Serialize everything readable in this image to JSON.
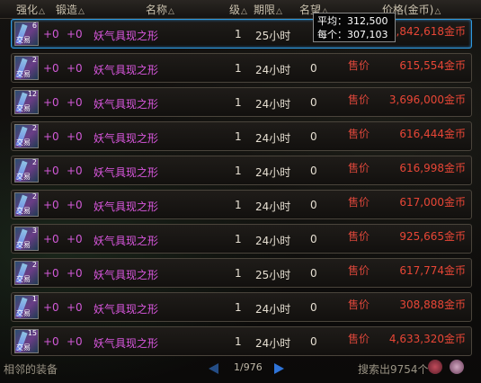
{
  "header": {
    "enhance": "强化",
    "forge": "锻造",
    "name": "名称",
    "level": "级",
    "period": "期限",
    "reputation": "名望",
    "price": "价格(金币)",
    "sort_glyph": "△"
  },
  "tooltip": {
    "avg": "平均：312,500",
    "each": "每个：307,103"
  },
  "rows": [
    {
      "stack": "6",
      "trade": "交易",
      "enhance": "+0",
      "forge": "+0",
      "name": "妖气具现之形",
      "level": "1",
      "period": "25小时",
      "reputation": "",
      "sale": "",
      "price": "1,842,618金币"
    },
    {
      "stack": "2",
      "trade": "交易",
      "enhance": "+0",
      "forge": "+0",
      "name": "妖气具现之形",
      "level": "1",
      "period": "24小时",
      "reputation": "0",
      "sale": "售价",
      "price": "615,554金币"
    },
    {
      "stack": "12",
      "trade": "交易",
      "enhance": "+0",
      "forge": "+0",
      "name": "妖气具现之形",
      "level": "1",
      "period": "24小时",
      "reputation": "0",
      "sale": "售价",
      "price": "3,696,000金币"
    },
    {
      "stack": "2",
      "trade": "交易",
      "enhance": "+0",
      "forge": "+0",
      "name": "妖气具现之形",
      "level": "1",
      "period": "24小时",
      "reputation": "0",
      "sale": "售价",
      "price": "616,444金币"
    },
    {
      "stack": "2",
      "trade": "交易",
      "enhance": "+0",
      "forge": "+0",
      "name": "妖气具现之形",
      "level": "1",
      "period": "24小时",
      "reputation": "0",
      "sale": "售价",
      "price": "616,998金币"
    },
    {
      "stack": "2",
      "trade": "交易",
      "enhance": "+0",
      "forge": "+0",
      "name": "妖气具现之形",
      "level": "1",
      "period": "24小时",
      "reputation": "0",
      "sale": "售价",
      "price": "617,000金币"
    },
    {
      "stack": "3",
      "trade": "交易",
      "enhance": "+0",
      "forge": "+0",
      "name": "妖气具现之形",
      "level": "1",
      "period": "24小时",
      "reputation": "0",
      "sale": "售价",
      "price": "925,665金币"
    },
    {
      "stack": "2",
      "trade": "交易",
      "enhance": "+0",
      "forge": "+0",
      "name": "妖气具现之形",
      "level": "1",
      "period": "25小时",
      "reputation": "0",
      "sale": "售价",
      "price": "617,774金币"
    },
    {
      "stack": "1",
      "trade": "交易",
      "enhance": "+0",
      "forge": "+0",
      "name": "妖气具现之形",
      "level": "1",
      "period": "24小时",
      "reputation": "0",
      "sale": "售价",
      "price": "308,888金币"
    },
    {
      "stack": "15",
      "trade": "交易",
      "enhance": "+0",
      "forge": "+0",
      "name": "妖气具现之形",
      "level": "1",
      "period": "24小时",
      "reputation": "0",
      "sale": "售价",
      "price": "4,633,320金币"
    }
  ],
  "footer": {
    "left_text": "相邻的装备",
    "page": "1/976",
    "search_result": "搜索出9754个"
  },
  "colors": {
    "name": "#d957de",
    "price": "#e84636",
    "selected_border": "#2f9ae0"
  }
}
